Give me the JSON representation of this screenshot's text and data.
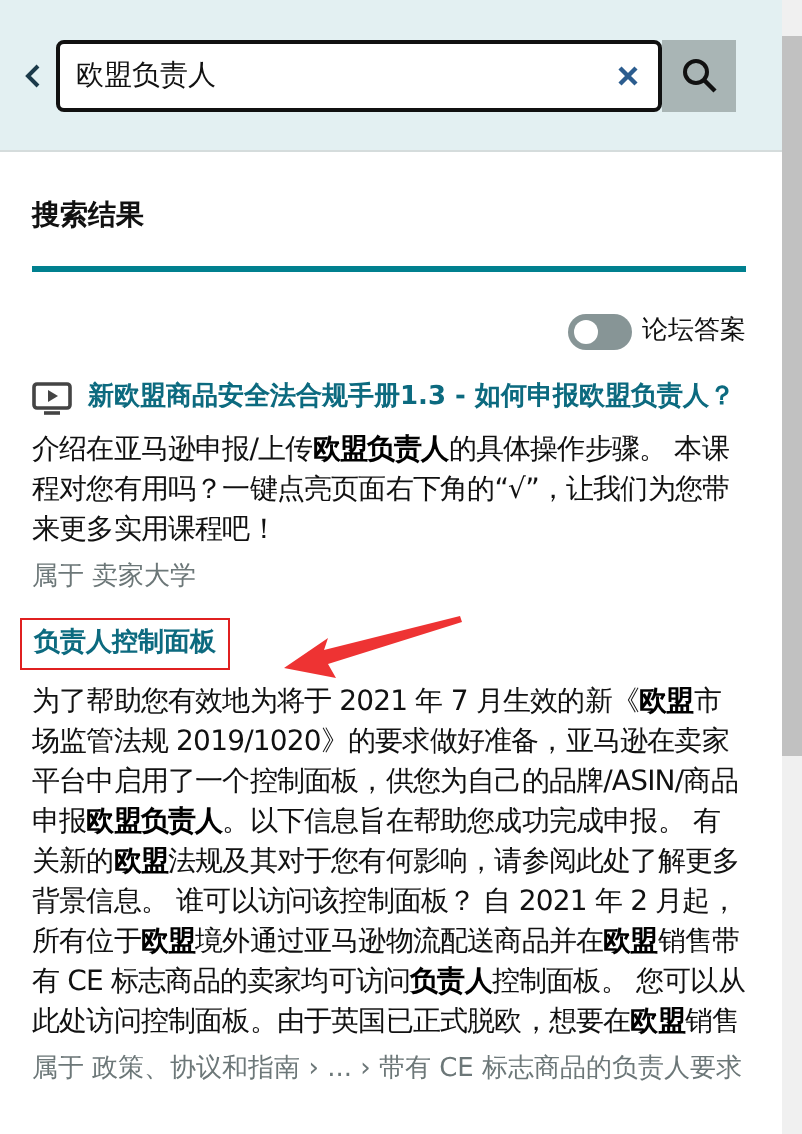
{
  "search": {
    "value": "欧盟负责人"
  },
  "section_title": "搜索结果",
  "forum_toggle": {
    "label": "论坛答案",
    "on": false
  },
  "results": [
    {
      "kind": "video",
      "title": "新欧盟商品安全法合规手册1.3 - 如何申报欧盟负责人？",
      "highlighted": false,
      "description": "介绍在亚马逊申报/上传**欧盟负责人**的具体操作步骤。 本课程对您有用吗？一键点亮页面右下角的“√”，让我们为您带来更多实用课程吧！",
      "meta": "属于 卖家大学"
    },
    {
      "kind": "article",
      "title": "负责人控制面板",
      "highlighted": true,
      "description": "为了帮助您有效地为将于 2021 年 7 月生效的新《**欧盟**市场监管法规 2019/1020》的要求做好准备，亚马逊在卖家平台中启用了一个控制面板，供您为自己的品牌/ASIN/商品申报**欧盟负责人**。以下信息旨在帮助您成功完成申报。 有关新的**欧盟**法规及其对于您有何影响，请参阅此处了解更多背景信息。 谁可以访问该控制面板？ 自 2021 年 2 月起，所有位于**欧盟**境外通过亚马逊物流配送商品并在**欧盟**销售带有 CE 标志商品的卖家均可访问**负责人**控制面板。 您可以从此处访问控制面板。由于英国已正式脱欧，想要在**欧盟**销售",
      "meta": "属于 政策、协议和指南 › ... › 带有 CE 标志商品的负责人要求"
    }
  ]
}
